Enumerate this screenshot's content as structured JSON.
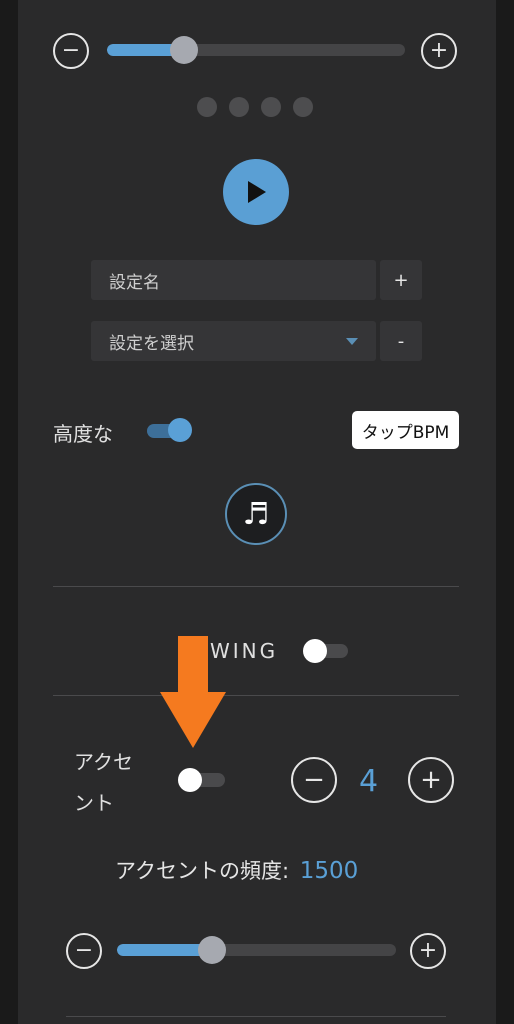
{
  "top_slider": {
    "value_percent": 26,
    "minus_label": "−",
    "plus_label": "+"
  },
  "pager": {
    "dot_count": 4
  },
  "controls": {
    "setting_name_placeholder": "設定名",
    "add_label": "+",
    "select_placeholder": "設定を選択",
    "remove_label": "-"
  },
  "advanced": {
    "label": "高度な",
    "enabled": true
  },
  "tap_bpm": {
    "label": "タップBPM"
  },
  "swing": {
    "label": "WING",
    "enabled": false
  },
  "accent": {
    "label_line1": "アクセ",
    "label_line2": "ント",
    "enabled": false,
    "count": "4",
    "minus_label": "−",
    "plus_label": "+"
  },
  "accent_frequency": {
    "label": "アクセントの頻度:",
    "value": "1500"
  },
  "bottom_slider": {
    "value_percent": 34,
    "minus_label": "−",
    "plus_label": "+"
  },
  "colors": {
    "accent": "#5aa0d6",
    "annotation_arrow": "#f57a1f",
    "panel": "#2a2a2b"
  }
}
